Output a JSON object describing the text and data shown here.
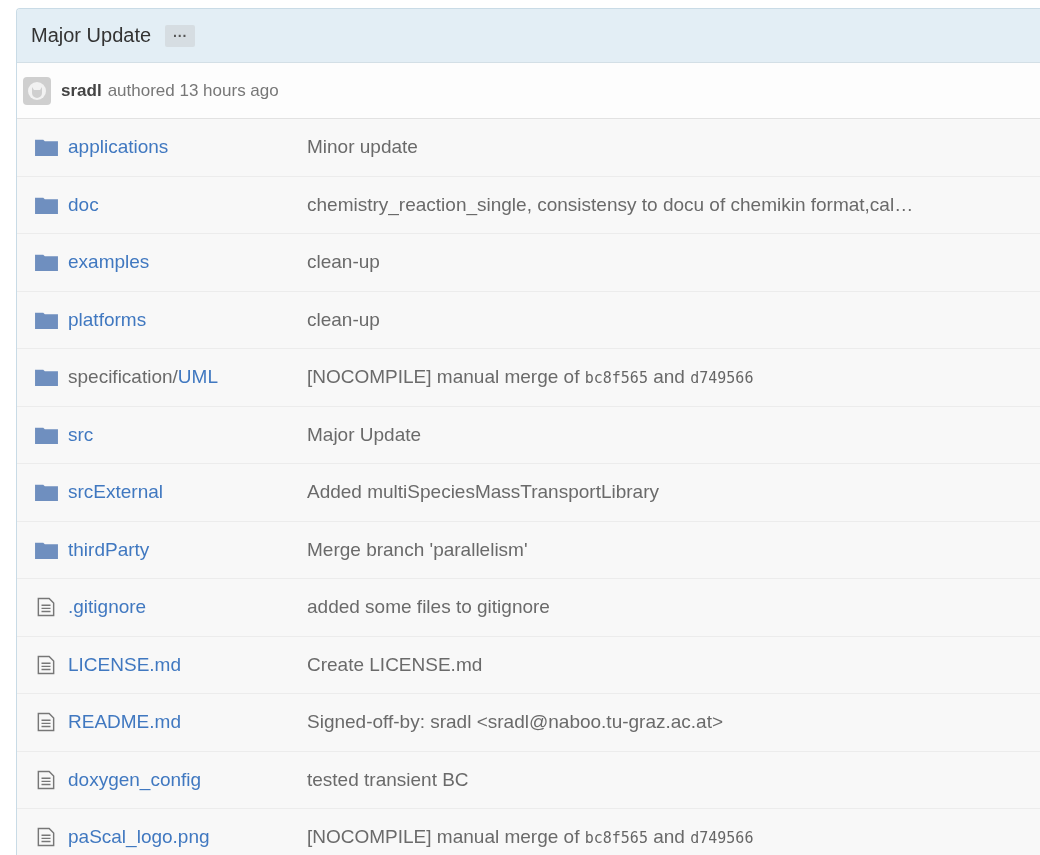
{
  "commit": {
    "message": "Major Update",
    "more_button": "···",
    "author": "sradl",
    "authored": "authored 13 hours ago"
  },
  "files": [
    {
      "kind": "folder",
      "name": "applications",
      "message": [
        {
          "text": "Minor update"
        }
      ]
    },
    {
      "kind": "folder",
      "name": "doc",
      "message": [
        {
          "text": "chemistry_reaction_single, consistensy to docu of chemikin format,cal…"
        }
      ]
    },
    {
      "kind": "folder",
      "name": "examples",
      "message": [
        {
          "text": "clean-up"
        }
      ]
    },
    {
      "kind": "folder",
      "name": "platforms",
      "message": [
        {
          "text": "clean-up"
        }
      ]
    },
    {
      "kind": "folder",
      "prefix": "specification/",
      "name": "UML",
      "message": [
        {
          "text": "[NOCOMPILE] manual merge of "
        },
        {
          "text": "bc8f565",
          "kind": "code"
        },
        {
          "text": " and "
        },
        {
          "text": "d749566",
          "kind": "code"
        }
      ]
    },
    {
      "kind": "folder",
      "name": "src",
      "message": [
        {
          "text": "Major Update"
        }
      ]
    },
    {
      "kind": "folder",
      "name": "srcExternal",
      "message": [
        {
          "text": "Added multiSpeciesMassTransportLibrary"
        }
      ]
    },
    {
      "kind": "folder",
      "name": "thirdParty",
      "message": [
        {
          "text": "Merge branch 'parallelism'"
        }
      ]
    },
    {
      "kind": "file",
      "name": ".gitignore",
      "message": [
        {
          "text": "added some files to gitignore"
        }
      ]
    },
    {
      "kind": "file",
      "name": "LICENSE.md",
      "message": [
        {
          "text": "Create LICENSE.md"
        }
      ]
    },
    {
      "kind": "file",
      "name": "README.md",
      "message": [
        {
          "text": "Signed-off-by: sradl <sradl@naboo.tu-graz.ac.at>"
        }
      ]
    },
    {
      "kind": "file",
      "name": "doxygen_config",
      "message": [
        {
          "text": "tested transient BC"
        }
      ]
    },
    {
      "kind": "file",
      "name": "paScal_logo.png",
      "message": [
        {
          "text": "[NOCOMPILE] manual merge of "
        },
        {
          "text": "bc8f565",
          "kind": "code"
        },
        {
          "text": " and "
        },
        {
          "text": "d749566",
          "kind": "code"
        }
      ]
    }
  ]
}
